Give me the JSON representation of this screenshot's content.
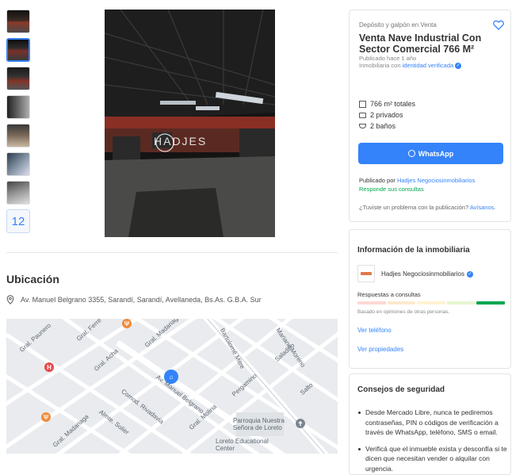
{
  "gallery": {
    "more_count": "12",
    "watermark": "HADJES"
  },
  "location": {
    "title": "Ubicación",
    "address": "Av. Manuel Belgrano 3355, Sarandí, Sarandí, Avellaneda, Bs.As. G.B.A. Sur"
  },
  "map": {
    "labels": [
      "Gral. Paunero",
      "Gral. Ferré",
      "Gral. Madariaga",
      "Gral. Acha",
      "Av. Manuel Belgrano",
      "Bartolomé Mitre",
      "Mariano Moreno",
      "Saladillo",
      "Salto",
      "Pergamino",
      "Comod. Rivadavia",
      "Almte. Solier",
      "Gral. Madariaga",
      "Gral. Molina",
      "Parroquia Nuestra Señora de Loreto",
      "Loreto Educational Center"
    ]
  },
  "listing": {
    "condition": "Depósito y galpón en Venta",
    "title": "Venta Nave Industrial Con Sector Comercial 766 M²",
    "published": "Publicado hace 1 año",
    "agency_prefix": "Inmobiliaria con",
    "verified_label": "identidad verificada",
    "attributes": {
      "area": "766 m² totales",
      "rooms": "2 privados",
      "baths": "2 baños"
    },
    "whatsapp_label": "WhatsApp",
    "published_by_prefix": "Publicado por",
    "publisher": "Hadjes Negociosinmobiliarios",
    "responds": "Responde sus consultas",
    "problem_text": "¿Tuviste un problema con la publicación?",
    "problem_link": "Avísanos."
  },
  "agency_info": {
    "title": "Información de la inmobiliaria",
    "name": "Hadjes Negociosinmobiliarios",
    "responses_label": "Respuestas a consultas",
    "based_on": "Basado en opiniones de otras personas.",
    "phone_link": "Ver teléfono",
    "properties_link": "Ver propiedades",
    "thermometer_level": 5,
    "thermometer_colors": [
      "#fdd9d7",
      "#fde9cf",
      "#fff3d1",
      "#e6f5d0",
      "#00a650"
    ]
  },
  "safety": {
    "title": "Consejos de seguridad",
    "tips": [
      "Desde Mercado Libre, nunca te pediremos contraseñas, PIN o códigos de verificación a través de WhatsApp, teléfono, SMS o email.",
      "Verificá que el inmueble exista y desconfía si te dicen que necesitan vender o alquilar con urgencia."
    ]
  },
  "colors": {
    "accent": "#3483fa",
    "success": "#00a650"
  }
}
